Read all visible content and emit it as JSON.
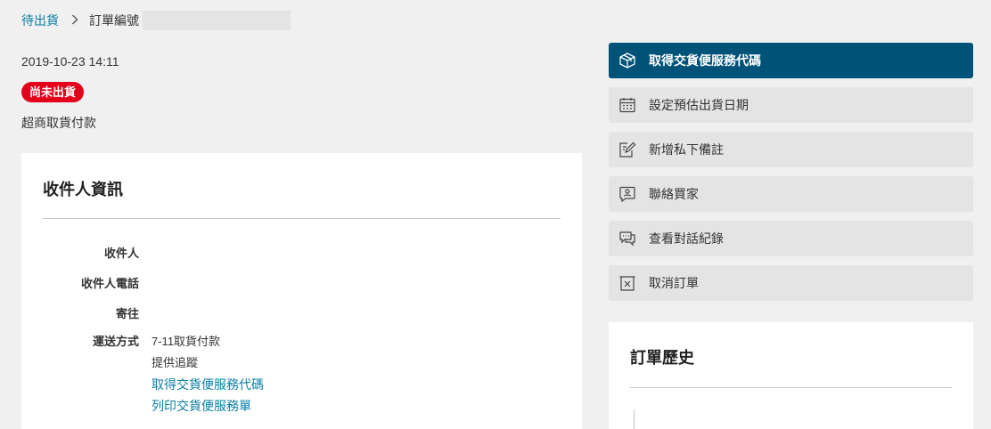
{
  "breadcrumb": {
    "parent": "待出貨",
    "current": "訂單編號"
  },
  "order": {
    "date": "2019-10-23 14:11",
    "status": "尚未出貨",
    "payment": "超商取貨付款"
  },
  "recipient": {
    "title": "收件人資訊",
    "labels": {
      "name": "收件人",
      "phone": "收件人電話",
      "address": "寄往",
      "shipping": "運送方式"
    },
    "shipping_method": "7-11取貨付款",
    "tracking": "提供追蹤",
    "links": {
      "get_code": "取得交貨便服務代碼",
      "print_form": "列印交貨便服務單"
    }
  },
  "actions": [
    {
      "label": "取得交貨便服務代碼",
      "icon": "package-icon",
      "primary": true
    },
    {
      "label": "設定預估出貨日期",
      "icon": "calendar-icon",
      "primary": false
    },
    {
      "label": "新增私下備註",
      "icon": "edit-note-icon",
      "primary": false
    },
    {
      "label": "聯絡買家",
      "icon": "contact-buyer-icon",
      "primary": false
    },
    {
      "label": "查看對話紀錄",
      "icon": "chat-icon",
      "primary": false
    },
    {
      "label": "取消訂單",
      "icon": "cancel-order-icon",
      "primary": false
    }
  ],
  "history": {
    "title": "訂單歷史"
  },
  "colors": {
    "accent": "#005378",
    "link": "#0a7ea4",
    "status": "#e3001b",
    "background": "#f0f0f0",
    "button": "#e4e4e4"
  }
}
